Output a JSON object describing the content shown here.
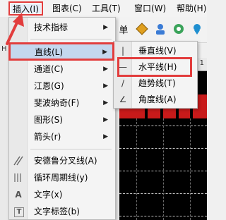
{
  "menubar": {
    "items": [
      {
        "label": "插入(I)"
      },
      {
        "label": "图表(C)"
      },
      {
        "label": "工具(T)"
      },
      {
        "label": "窗口(W)"
      },
      {
        "label": "帮助(H)"
      }
    ]
  },
  "left_panel": {
    "label": "H"
  },
  "toolbar": {
    "partial_label": "单",
    "icons": [
      "diamond-icon",
      "person-icon",
      "radio-icon",
      "ribbon-icon"
    ]
  },
  "chart": {
    "header_text": "05 1"
  },
  "insert_menu": {
    "items": [
      {
        "label": "技术指标",
        "has_submenu": true
      },
      {
        "label": "直线(L)",
        "has_submenu": true,
        "selected": true
      },
      {
        "label": "通道(C)",
        "has_submenu": true
      },
      {
        "label": "江恩(G)",
        "has_submenu": true
      },
      {
        "label": "斐波纳奇(F)",
        "has_submenu": true
      },
      {
        "label": "图形(S)",
        "has_submenu": true
      },
      {
        "label": "箭头(r)",
        "has_submenu": true
      },
      {
        "label": "安德鲁分叉线(A)",
        "icon": "andrews-pitchfork-icon"
      },
      {
        "label": "循环周期线(y)",
        "icon": "cycle-lines-icon"
      },
      {
        "label": "文字(x)",
        "icon": "text-icon",
        "icon_glyph": "A"
      },
      {
        "label": "文字标签(b)",
        "icon": "text-label-icon",
        "icon_glyph": "T"
      }
    ],
    "arrow_glyph": "▶"
  },
  "line_submenu": {
    "items": [
      {
        "label": "垂直线(V)",
        "icon_glyph": "|"
      },
      {
        "label": "水平线(H)",
        "icon_glyph": "—",
        "highlighted": true
      },
      {
        "label": "趋势线(T)",
        "icon_glyph": "/"
      },
      {
        "label": "角度线(A)",
        "icon_glyph": "∠"
      }
    ]
  },
  "colors": {
    "highlight": "#e23d3d",
    "selection": "#c4d7ee",
    "chart_bg": "#000000",
    "chart_red": "#c81a1a"
  }
}
